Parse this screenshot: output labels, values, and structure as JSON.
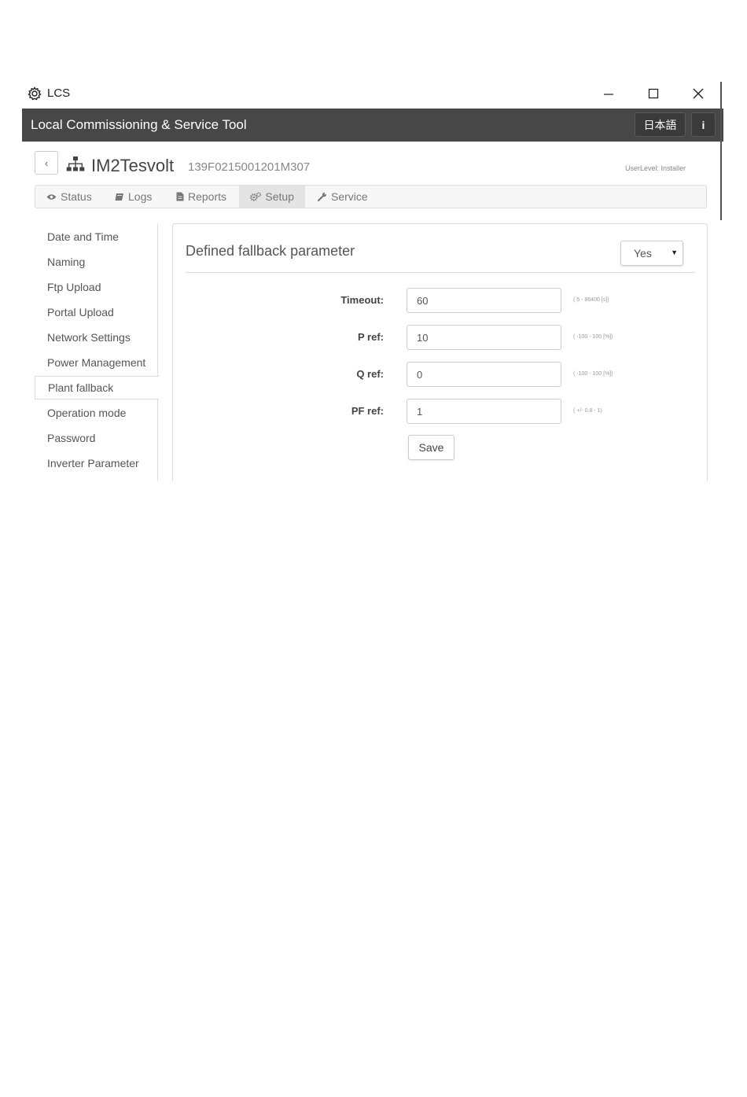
{
  "window": {
    "app_name": "LCS",
    "app_icon": "gear-icon",
    "controls": [
      "minimize-icon",
      "maximize-icon",
      "close-icon"
    ]
  },
  "header": {
    "title": "Local Commissioning & Service Tool",
    "language_button": "日本語",
    "info_button": "i"
  },
  "device": {
    "name": "IM2Tesvolt",
    "serial": "139F0215001201M307",
    "user_level": "UserLevel: Installer"
  },
  "tabs": [
    {
      "label": "Status",
      "icon": "eye-icon"
    },
    {
      "label": "Logs",
      "icon": "book-icon"
    },
    {
      "label": "Reports",
      "icon": "file-icon"
    },
    {
      "label": "Setup",
      "icon": "gears-icon",
      "active": true
    },
    {
      "label": "Service",
      "icon": "wrench-icon"
    }
  ],
  "sidebar": {
    "items": [
      {
        "label": "Date and Time"
      },
      {
        "label": "Naming"
      },
      {
        "label": "Ftp Upload"
      },
      {
        "label": "Portal Upload"
      },
      {
        "label": "Network Settings"
      },
      {
        "label": "Power Management"
      },
      {
        "label": "Plant fallback",
        "active": true
      },
      {
        "label": "Operation mode"
      },
      {
        "label": "Password"
      },
      {
        "label": "Inverter Parameter"
      }
    ]
  },
  "panel": {
    "title": "Defined fallback parameter",
    "select_value": "Yes",
    "fields": [
      {
        "label": "Timeout:",
        "value": "60",
        "range": "( 5 - 86400 [s])"
      },
      {
        "label": "P ref:",
        "value": "10",
        "range": "( -100 - 100 [%])"
      },
      {
        "label": "Q ref:",
        "value": "0",
        "range": "( -100 - 100 [%])"
      },
      {
        "label": "PF ref:",
        "value": "1",
        "range": "( +/- 0.8 - 1)"
      }
    ],
    "save_label": "Save"
  }
}
